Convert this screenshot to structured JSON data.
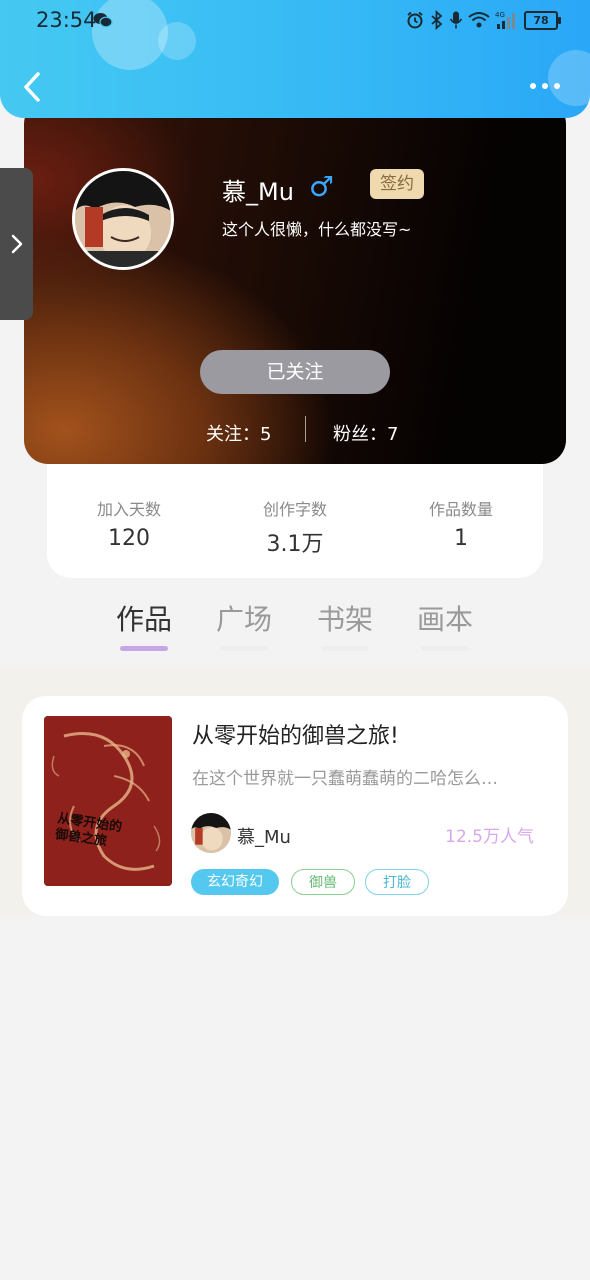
{
  "status_bar": {
    "time": "23:54",
    "battery": "78"
  },
  "profile": {
    "username": "慕_Mu",
    "gender_icon": "male-icon",
    "badge": "签约",
    "bio": "这个人很懒，什么都没写~",
    "follow_button": "已关注",
    "follows_text": "关注：5",
    "fans_text": "粉丝：7"
  },
  "stats": [
    {
      "label": "加入天数",
      "value": "120"
    },
    {
      "label": "创作字数",
      "value": "3.1万"
    },
    {
      "label": "作品数量",
      "value": "1"
    }
  ],
  "tabs": [
    {
      "label": "作品",
      "active": true
    },
    {
      "label": "广场",
      "active": false
    },
    {
      "label": "书架",
      "active": false
    },
    {
      "label": "画本",
      "active": false
    }
  ],
  "works": [
    {
      "title": "从零开始的御兽之旅!",
      "description": "在这个世界就一只蠢萌蠢萌的二哈怎么…",
      "author": "慕_Mu",
      "popularity": "12.5万人气",
      "cover_text": "从零开始的御兽之旅",
      "tags": [
        "玄幻奇幻",
        "御兽",
        "打脸"
      ]
    }
  ],
  "colors": {
    "header": "#35b8f5",
    "accent_purple": "#c7a6e6",
    "follow_button_bg": "#9b9aa0",
    "badge_bg": "#efdab0"
  }
}
